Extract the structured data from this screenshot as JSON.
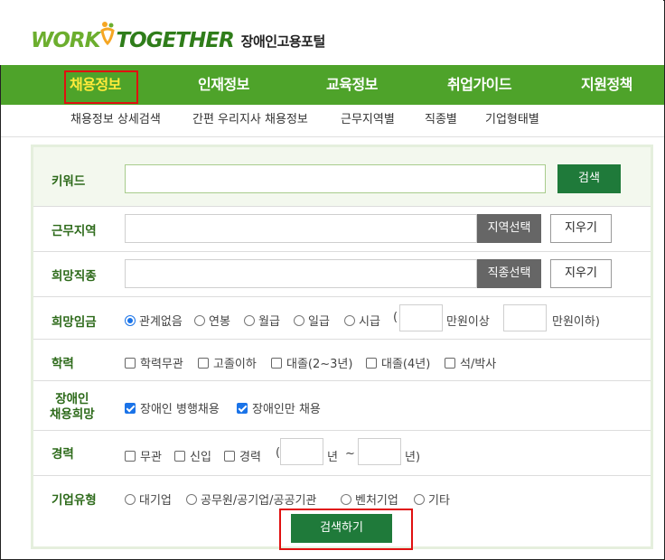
{
  "header": {
    "logo_part1": "WORK",
    "logo_part2": "TOGETHER",
    "site_name": "장애인고용포털"
  },
  "nav": {
    "items": [
      {
        "label": "채용정보",
        "active": true
      },
      {
        "label": "인재정보"
      },
      {
        "label": "교육정보"
      },
      {
        "label": "취업가이드"
      },
      {
        "label": "지원정책"
      }
    ]
  },
  "subnav": {
    "items": [
      "채용정보 상세검색",
      "간편 우리지사 채용정보",
      "근무지역별",
      "직종별",
      "기업형태별"
    ]
  },
  "form": {
    "keyword": {
      "label": "키워드",
      "value": "",
      "search_button": "검색"
    },
    "region": {
      "label": "근무지역",
      "value": "",
      "select_button": "지역선택",
      "clear_button": "지우기"
    },
    "job": {
      "label": "희망직종",
      "value": "",
      "select_button": "직종선택",
      "clear_button": "지우기"
    },
    "wage": {
      "label": "희망임금",
      "options": [
        "관계없음",
        "연봉",
        "월급",
        "일급",
        "시급"
      ],
      "selected": "관계없음",
      "paren_open": "(",
      "min_suffix": "만원이상",
      "max_suffix": "만원이하)"
    },
    "education": {
      "label": "학력",
      "options": [
        "학력무관",
        "고졸이하",
        "대졸(2~3년)",
        "대졸(4년)",
        "석/박사"
      ]
    },
    "disability": {
      "label_line1": "장애인",
      "label_line2": "채용희망",
      "options": [
        "장애인 병행채용",
        "장애인만 채용"
      ],
      "checked": [
        true,
        true
      ]
    },
    "career": {
      "label": "경력",
      "options": [
        "무관",
        "신입",
        "경력"
      ],
      "paren_open": "(",
      "year_label": "년",
      "tilde": "~",
      "year_close": "년)"
    },
    "company_type": {
      "label": "기업유형",
      "options": [
        "대기업",
        "공무원/공기업/공공기관",
        "벤처기업",
        "기타"
      ]
    },
    "submit_label": "검색하기"
  },
  "colors": {
    "nav_green": "#4ea32a",
    "button_green": "#1f7a3a",
    "active_nav_text": "#ffea3a",
    "highlight_red": "#e01010"
  }
}
